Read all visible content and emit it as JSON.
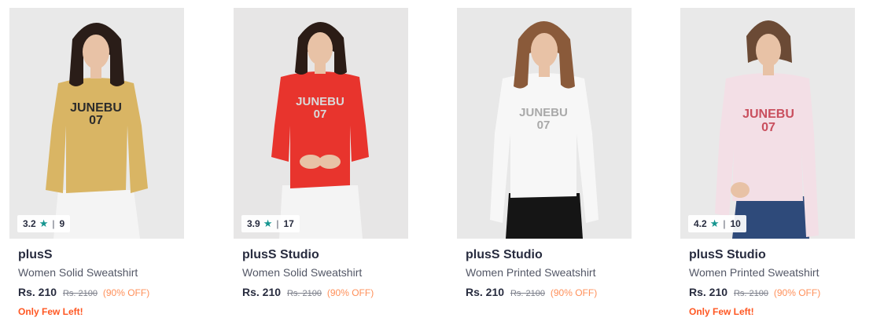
{
  "products": [
    {
      "brand": "plusS",
      "title": "Women Solid Sweatshirt",
      "price": "Rs. 210",
      "mrp": "Rs. 2100",
      "discount": "(90% OFF)",
      "rating": "3.2",
      "rating_count": "9",
      "stock_note": "Only Few Left!",
      "print_line1": "JUNEBU",
      "print_line2": "07",
      "colors": {
        "background": "#e9e9e9",
        "sweatshirt": "#d9b564",
        "print": "#2b2b2b",
        "pants": "#f4f4f4",
        "hair": "#2a1d18"
      }
    },
    {
      "brand": "plusS Studio",
      "title": "Women Solid Sweatshirt",
      "price": "Rs. 210",
      "mrp": "Rs. 2100",
      "discount": "(90% OFF)",
      "rating": "3.9",
      "rating_count": "17",
      "stock_note": "",
      "print_line1": "JUNEBU",
      "print_line2": "07",
      "colors": {
        "background": "#e7e6e6",
        "sweatshirt": "#e8342d",
        "print": "#d9d9d9",
        "pants": "#f4f4f4",
        "hair": "#2b1c16"
      }
    },
    {
      "brand": "plusS Studio",
      "title": "Women Printed Sweatshirt",
      "price": "Rs. 210",
      "mrp": "Rs. 2100",
      "discount": "(90% OFF)",
      "rating": "",
      "rating_count": "",
      "stock_note": "",
      "print_line1": "JUNEBU",
      "print_line2": "07",
      "colors": {
        "background": "#e8e8e8",
        "sweatshirt": "#f7f7f7",
        "print": "#a9a9a9",
        "pants": "#151515",
        "hair": "#8a5a3a"
      }
    },
    {
      "brand": "plusS Studio",
      "title": "Women Printed Sweatshirt",
      "price": "Rs. 210",
      "mrp": "Rs. 2100",
      "discount": "(90% OFF)",
      "rating": "4.2",
      "rating_count": "10",
      "stock_note": "Only Few Left!",
      "print_line1": "JUNEBU",
      "print_line2": "07",
      "colors": {
        "background": "#e9e9e9",
        "sweatshirt": "#f3dfe6",
        "print": "#c94f5e",
        "pants": "#2e4a7a",
        "hair": "#6b4a35"
      }
    }
  ]
}
